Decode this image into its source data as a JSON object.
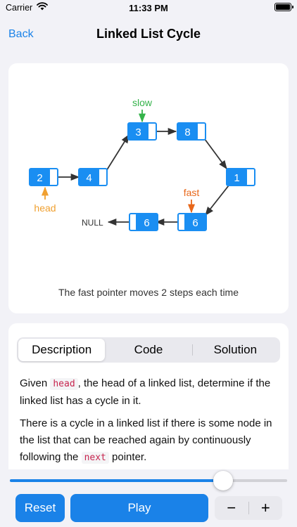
{
  "status_bar": {
    "carrier": "Carrier",
    "time": "11:33 PM"
  },
  "nav": {
    "back_label": "Back",
    "title": "Linked List Cycle"
  },
  "diagram": {
    "nodes": [
      {
        "id": "n2",
        "value": "2"
      },
      {
        "id": "n4",
        "value": "4"
      },
      {
        "id": "n3",
        "value": "3"
      },
      {
        "id": "n8",
        "value": "8"
      },
      {
        "id": "n1",
        "value": "1"
      },
      {
        "id": "n6b",
        "value": "6"
      },
      {
        "id": "n6a",
        "value": "6"
      }
    ],
    "null_label": "NULL",
    "pointers": {
      "slow": "slow",
      "fast": "fast",
      "head": "head"
    },
    "caption": "The fast pointer moves 2 steps each time",
    "colors": {
      "node": "#1a8ef2",
      "slow": "#34b34a",
      "fast": "#e8671a",
      "head": "#f0a030",
      "accent": "#1a82e8"
    }
  },
  "tabs": [
    {
      "label": "Description",
      "selected": true
    },
    {
      "label": "Code",
      "selected": false
    },
    {
      "label": "Solution",
      "selected": false
    }
  ],
  "description": {
    "p1": {
      "before": "Given ",
      "code": "head",
      "after": ", the head of a linked list, determine if the linked list has a cycle in it."
    },
    "p2": {
      "before": "There is a cycle in a linked list if there is some node in the list that can be reached again by continuously following the ",
      "code": "next",
      "after": " pointer."
    }
  },
  "slider": {
    "progress": 0.77
  },
  "controls": {
    "reset_label": "Reset",
    "play_label": "Play",
    "minus_label": "−",
    "plus_label": "+"
  }
}
